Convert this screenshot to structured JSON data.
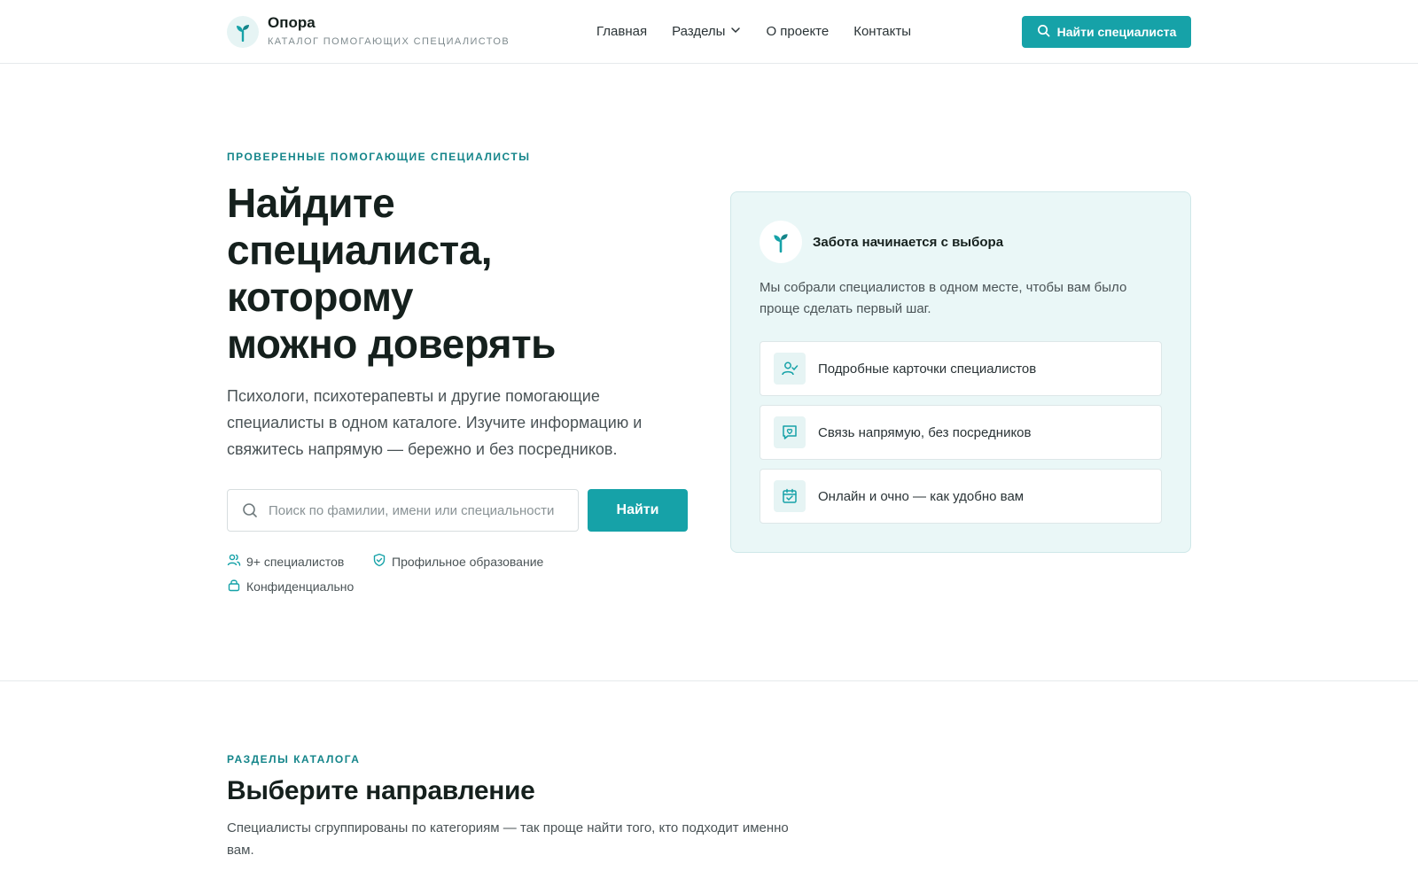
{
  "header": {
    "logo_name": "Опора",
    "logo_sub": "КАТАЛОГ ПОМОГАЮЩИХ СПЕЦИАЛИСТОВ",
    "nav": [
      {
        "label": "Главная"
      },
      {
        "label": "Разделы"
      },
      {
        "label": "О проекте"
      },
      {
        "label": "Контакты"
      }
    ],
    "cta_label": "Найти специалиста"
  },
  "hero": {
    "eyebrow": "ПРОВЕРЕННЫЕ ПОМОГАЮЩИЕ СПЕЦИАЛИСТЫ",
    "title_lines": [
      "Найдите",
      "специалиста,",
      "которому",
      "можно доверять"
    ],
    "lead": "Психологи, психотерапевты и другие помогающие специалисты в одном каталоге. Изучите информацию и свяжитесь напрямую — бережно и без посредников.",
    "search_placeholder": "Поиск по фамилии, имени или специальности",
    "search_button": "Найти",
    "badges": [
      {
        "label": "9+ специалистов",
        "icon": "users-icon"
      },
      {
        "label": "Профильное образование",
        "icon": "shield-check-icon"
      },
      {
        "label": "Конфиденциально",
        "icon": "lock-icon"
      }
    ]
  },
  "card": {
    "title": "Забота начинается с выбора",
    "text": "Мы собрали специалистов в одном месте, чтобы вам было проще сделать первый шаг.",
    "features": [
      {
        "label": "Подробные карточки специалистов",
        "icon": "user-check-icon"
      },
      {
        "label": "Связь напрямую, без посредников",
        "icon": "chat-heart-icon"
      },
      {
        "label": "Онлайн и очно — как удобно вам",
        "icon": "calendar-check-icon"
      }
    ]
  },
  "catalog": {
    "eyebrow": "РАЗДЕЛЫ КАТАЛОГА",
    "title": "Выберите направление",
    "text": "Специалисты сгруппированы по категориям — так проще найти того, кто подходит именно вам."
  },
  "colors": {
    "accent": "#16a2a8",
    "accent_dark": "#14858a",
    "card_bg": "#eaf7f7"
  }
}
